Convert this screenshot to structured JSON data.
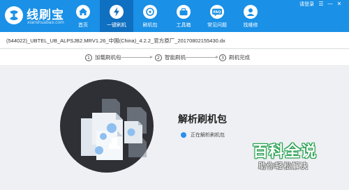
{
  "app": {
    "logo_title": "线刷宝",
    "logo_subtitle": "xianshuabao.com",
    "brand_color": "#1a90e6",
    "active_color": "#0f6fc0"
  },
  "nav": [
    {
      "label": "首页",
      "icon": "home-icon",
      "active": false
    },
    {
      "label": "一键刷机",
      "icon": "lightning-icon",
      "active": true
    },
    {
      "label": "刷机包",
      "icon": "package-icon",
      "active": false
    },
    {
      "label": "工具箱",
      "icon": "toolbox-icon",
      "active": false
    },
    {
      "label": "常见问题",
      "icon": "faq-icon",
      "active": false
    },
    {
      "label": "找维修",
      "icon": "repair-icon",
      "active": false
    }
  ],
  "topbar": {
    "login_label": "请登录",
    "menu_glyph": "☰",
    "minimize_glyph": "—",
    "close_glyph": "✕"
  },
  "filebar": {
    "filename": "(544022)_UBTEL_UB_ALPSJB2.MRV1.26_中国(China)_4.2.2_官方原厂_20170802155430.dx"
  },
  "steps": [
    {
      "num": "1",
      "label": "加载刷机包"
    },
    {
      "num": "2",
      "label": "智能刷机"
    },
    {
      "num": "3",
      "label": "刷机完成"
    }
  ],
  "main": {
    "title": "解析刷机包",
    "status_text": "正在解析刷机包",
    "status_color": "#2b8ef0"
  },
  "watermark": {
    "title": "百科全说",
    "subtitle": "助你轻松解决"
  }
}
